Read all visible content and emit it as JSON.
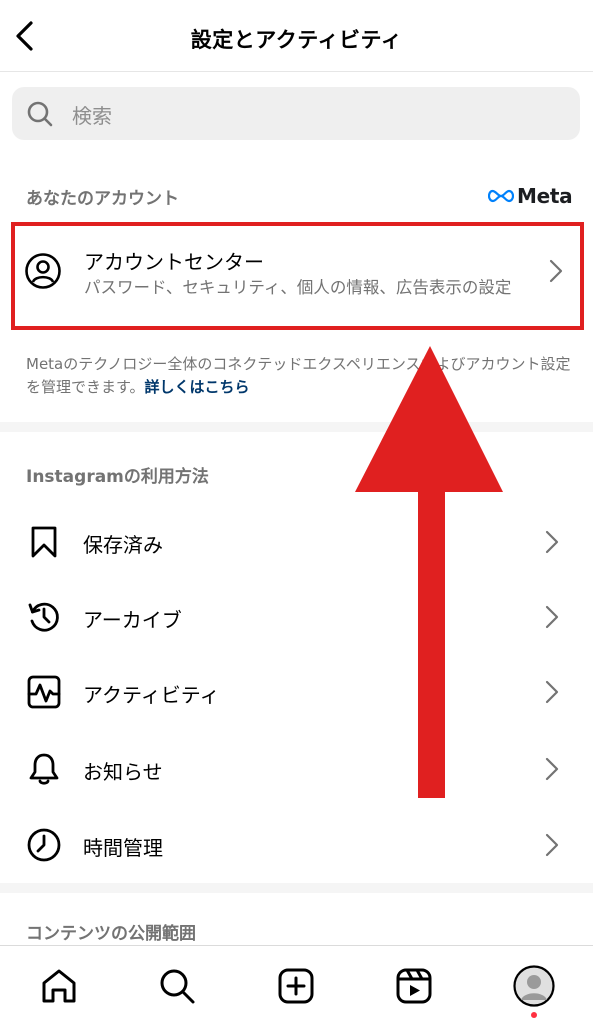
{
  "header": {
    "title": "設定とアクティビティ"
  },
  "search": {
    "placeholder": "検索"
  },
  "account_section": {
    "label": "あなたのアカウント",
    "meta_brand": "Meta",
    "account_center": {
      "title": "アカウントセンター",
      "subtitle": "パスワード、セキュリティ、個人の情報、広告表示の設定"
    },
    "info_text": "Metaのテクノロジー全体のコネクテッドエクスペリエンスおよびアカウント設定を管理できます。",
    "info_link": "詳しくはこちら"
  },
  "usage_section": {
    "label": "Instagramの利用方法",
    "items": [
      {
        "label": "保存済み",
        "icon": "bookmark-icon"
      },
      {
        "label": "アーカイブ",
        "icon": "archive-icon"
      },
      {
        "label": "アクティビティ",
        "icon": "activity-icon"
      },
      {
        "label": "お知らせ",
        "icon": "bell-icon"
      },
      {
        "label": "時間管理",
        "icon": "clock-icon"
      }
    ]
  },
  "content_section": {
    "label": "コンテンツの公開範囲"
  },
  "bottom_nav": {
    "items": [
      "home-icon",
      "search-icon",
      "create-icon",
      "reels-icon",
      "profile-avatar"
    ]
  },
  "colors": {
    "highlight": "#e02020",
    "link": "#00376b",
    "meta_blue": "#0081fb",
    "notification_dot": "#ff3040"
  }
}
